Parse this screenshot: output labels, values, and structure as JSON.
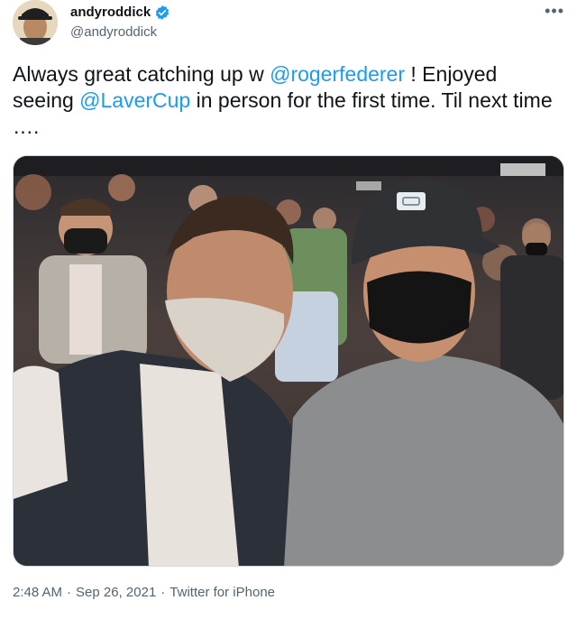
{
  "tweet": {
    "display_name": "andyroddick",
    "handle": "@andyroddick",
    "verified": true,
    "more_icon": "more-horizontal-icon",
    "text_parts": [
      {
        "type": "text",
        "value": "Always great catching up w "
      },
      {
        "type": "mention",
        "value": "@rogerfederer"
      },
      {
        "type": "text",
        "value": " ! Enjoyed seeing "
      },
      {
        "type": "mention",
        "value": "@LaverCup"
      },
      {
        "type": "text",
        "value": " in person for the first time. Til next time …."
      }
    ],
    "time": "2:48 AM",
    "date": "Sep 26, 2021",
    "source": "Twitter for iPhone",
    "separator": "·"
  },
  "colors": {
    "accent": "#1d9bf0",
    "text": "#0f1419",
    "secondary": "#536471"
  }
}
